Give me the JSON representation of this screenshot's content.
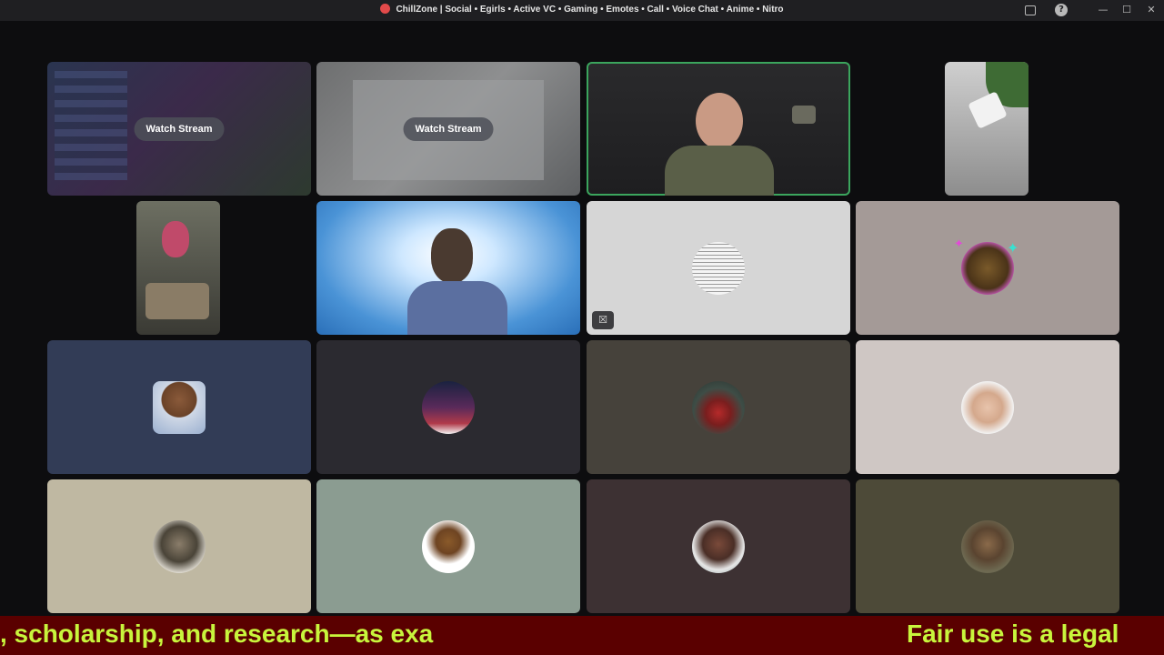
{
  "window": {
    "title": "ChillZone | Social • Egirls • Active VC • Gaming • Emotes • Call • Voice Chat • Anime • Nitro",
    "app_icon": "app-logo-icon",
    "controls": [
      "inbox-icon",
      "help-icon",
      "minimize-icon",
      "maximize-icon",
      "close-icon"
    ]
  },
  "call": {
    "watch_stream_label": "Watch Stream",
    "tiles": [
      {
        "type": "stream",
        "name": "stream-tile-1"
      },
      {
        "type": "stream",
        "name": "stream-tile-2"
      },
      {
        "type": "camera",
        "name": "camera-tile-soldier",
        "speaking": true
      },
      {
        "type": "camera",
        "name": "camera-tile-lamp"
      },
      {
        "type": "camera",
        "name": "camera-tile-pink-hair"
      },
      {
        "type": "camera",
        "name": "camera-tile-clouds"
      },
      {
        "type": "avatar",
        "name": "avatar-tile-document",
        "camera_off": true
      },
      {
        "type": "avatar",
        "name": "avatar-tile-sparkle"
      },
      {
        "type": "avatar",
        "name": "avatar-tile-bear"
      },
      {
        "type": "avatar",
        "name": "avatar-tile-city"
      },
      {
        "type": "avatar",
        "name": "avatar-tile-figurine"
      },
      {
        "type": "avatar",
        "name": "avatar-tile-man"
      },
      {
        "type": "avatar",
        "name": "avatar-tile-bearded"
      },
      {
        "type": "avatar",
        "name": "avatar-tile-dog"
      },
      {
        "type": "avatar",
        "name": "avatar-tile-doll"
      },
      {
        "type": "avatar",
        "name": "avatar-tile-waving"
      }
    ]
  },
  "ticker": {
    "left_text": ", scholarship, and research—as exa",
    "right_text": "Fair use is a legal"
  },
  "colors": {
    "speaking_outline": "#3ba55d",
    "ticker_bg": "#5a0000",
    "ticker_text": "#c8f53c"
  }
}
